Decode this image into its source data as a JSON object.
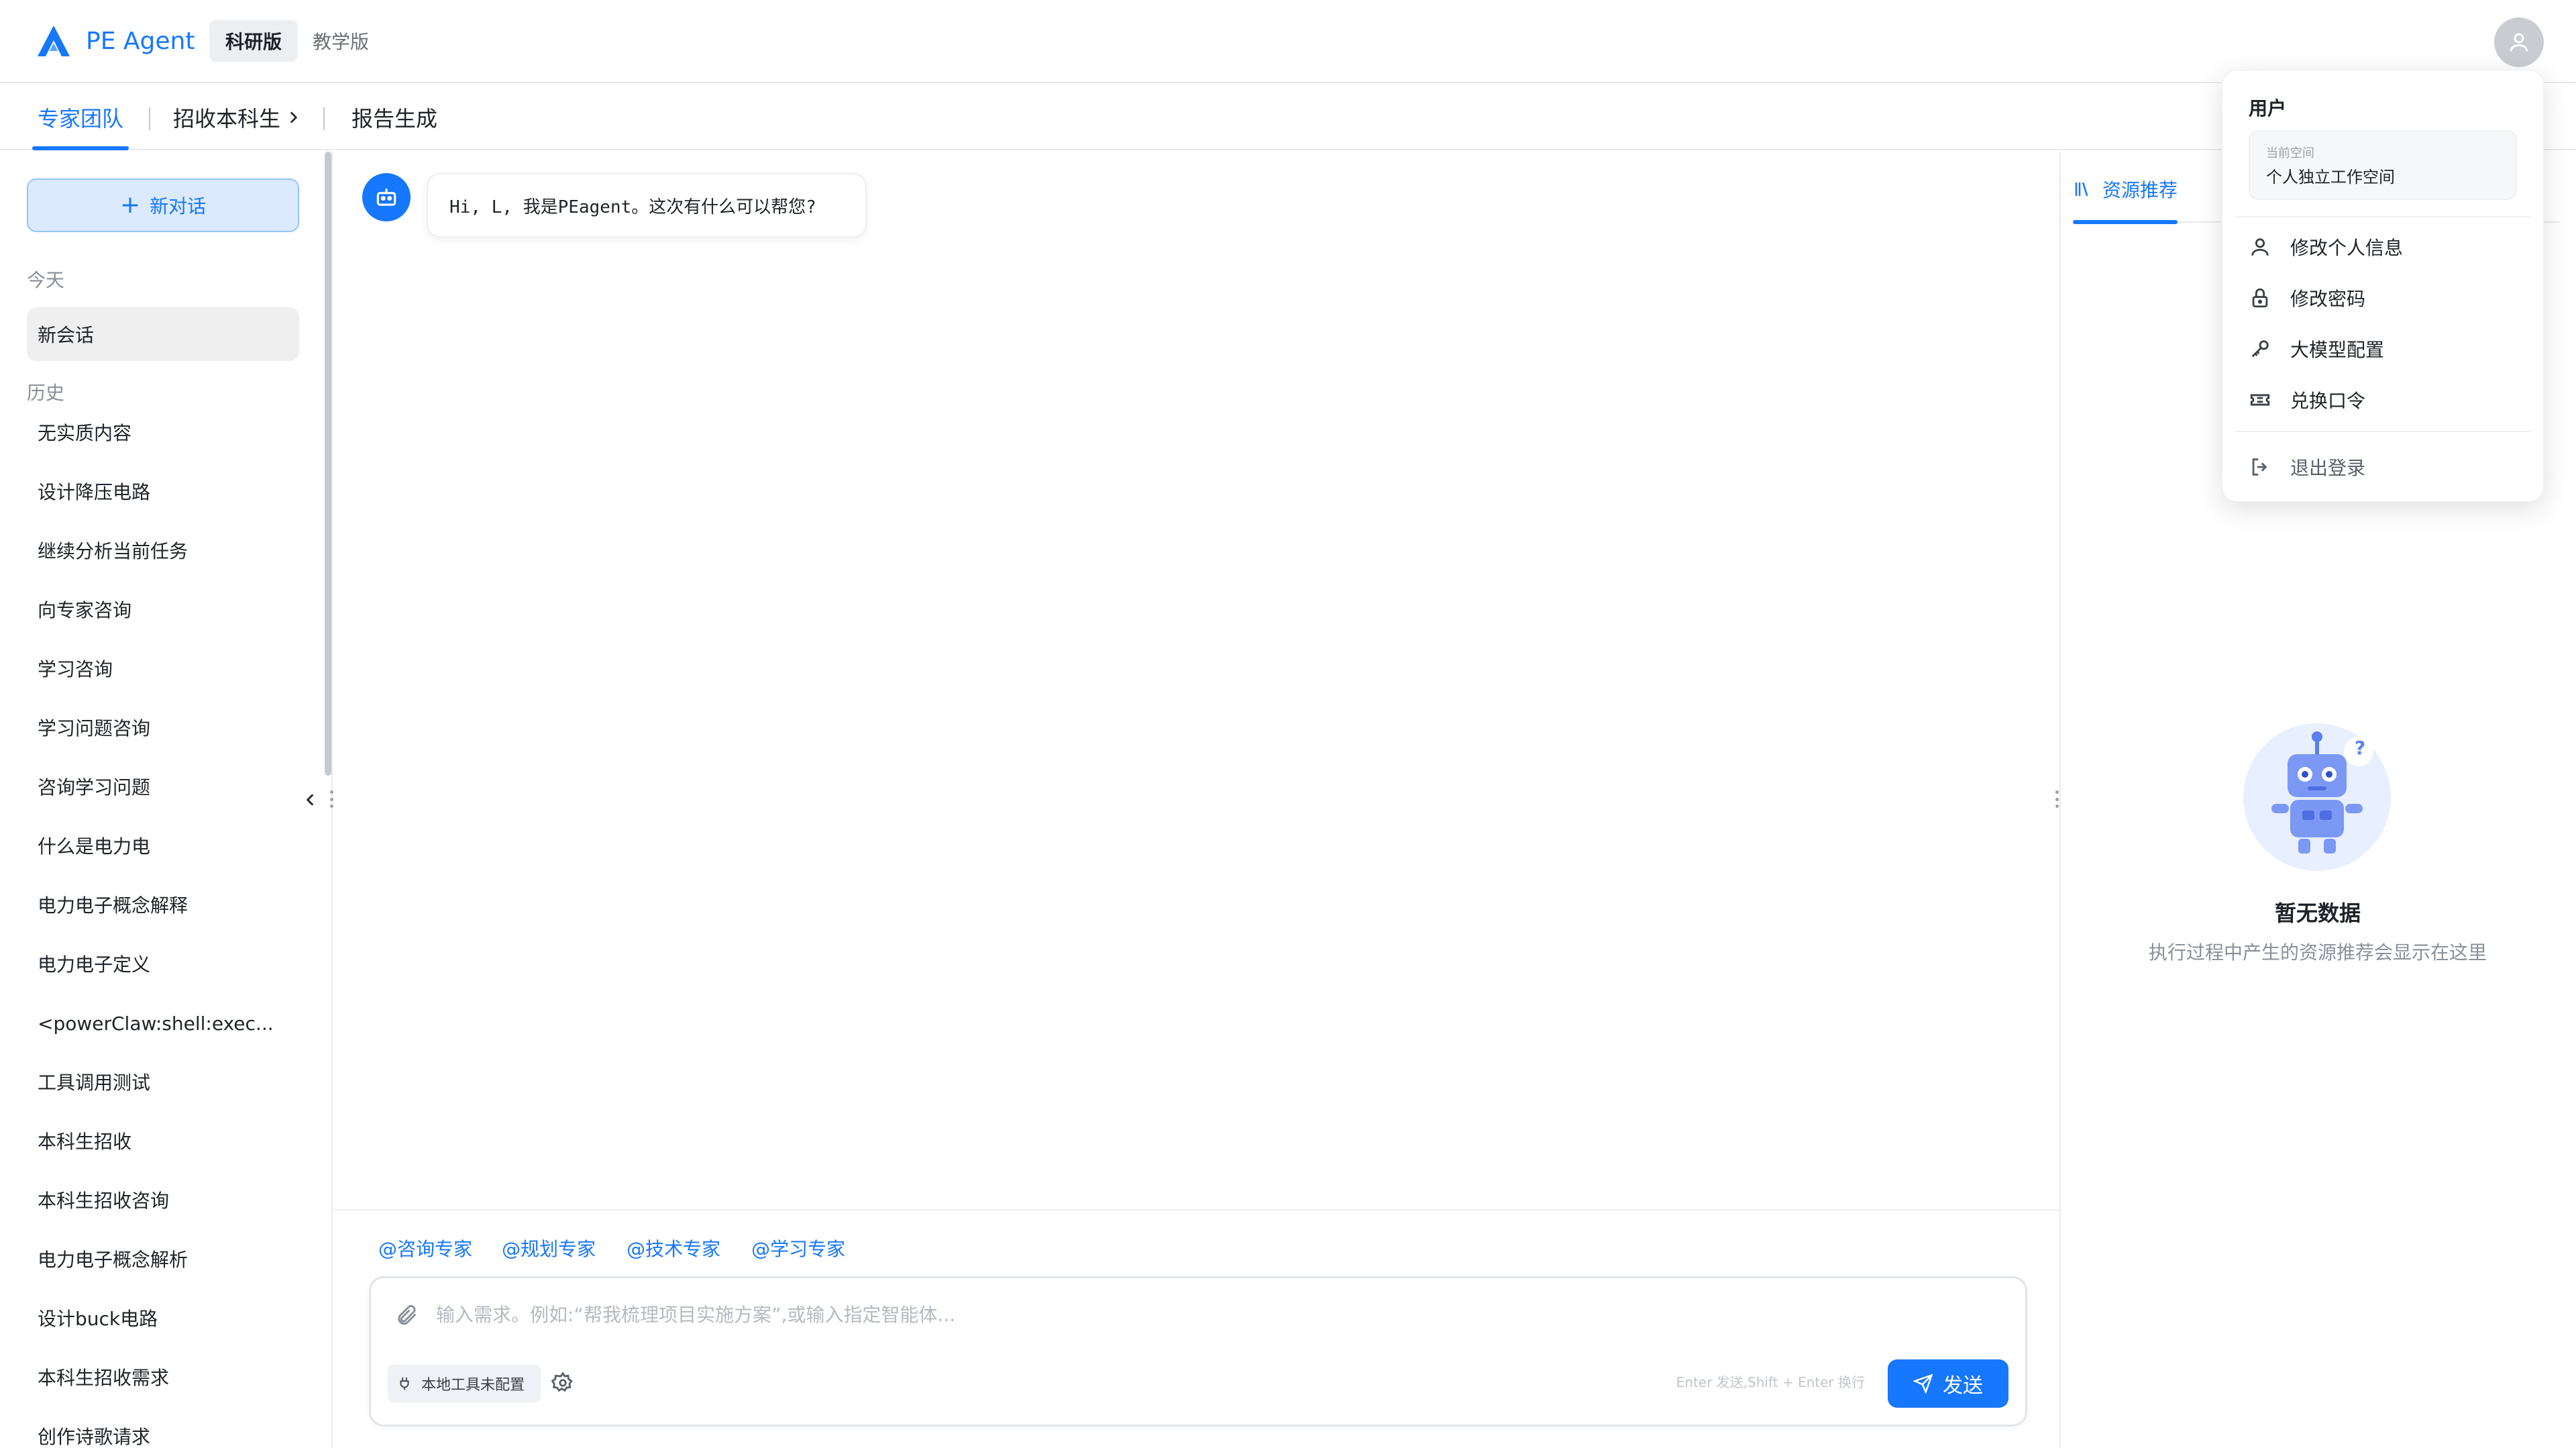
{
  "header": {
    "app_title": "PE Agent",
    "editions": [
      "科研版",
      "教学版"
    ],
    "active_edition": "科研版"
  },
  "tabs": [
    {
      "label": "专家团队",
      "active": true
    },
    {
      "label": "招收本科生",
      "has_chevron": true
    },
    {
      "label": "报告生成"
    }
  ],
  "sidebar": {
    "new_chat_label": "新对话",
    "today_label": "今天",
    "active_session": "新会话",
    "history_label": "历史",
    "history": [
      "无实质内容",
      "设计降压电路",
      "继续分析当前任务",
      "向专家咨询",
      "学习咨询",
      "学习问题咨询",
      "咨询学习问题",
      "什么是电力电",
      "电力电子概念解释",
      "电力电子定义",
      "<powerClaw:shell:exec...",
      "工具调用测试",
      "本科生招收",
      "本科生招收咨询",
      "电力电子概念解析",
      "设计buck电路",
      "本科生招收需求",
      "创作诗歌请求"
    ]
  },
  "chat": {
    "greeting": "Hi, L, 我是PEagent。这次有什么可以帮您?",
    "mentions": [
      "@咨询专家",
      "@规划专家",
      "@技术专家",
      "@学习专家"
    ],
    "input_placeholder": "输入需求。例如:“帮我梳理项目实施方案”,或输入指定智能体...",
    "tool_chip_label": "本地工具未配置",
    "shortcut_hint": "Enter 发送,Shift + Enter 换行",
    "send_label": "发送"
  },
  "right_panel": {
    "tab_label": "资源推荐",
    "empty_title": "暂无数据",
    "empty_desc": "执行过程中产生的资源推荐会显示在这里"
  },
  "user_menu": {
    "header": "用户",
    "workspace_label": "当前空间",
    "workspace_value": "个人独立工作空间",
    "items": [
      "修改个人信息",
      "修改密码",
      "大模型配置",
      "兑换口令"
    ],
    "logout": "退出登录"
  },
  "colors": {
    "accent": "#1677ff",
    "accent_light": "#dbeafe"
  }
}
